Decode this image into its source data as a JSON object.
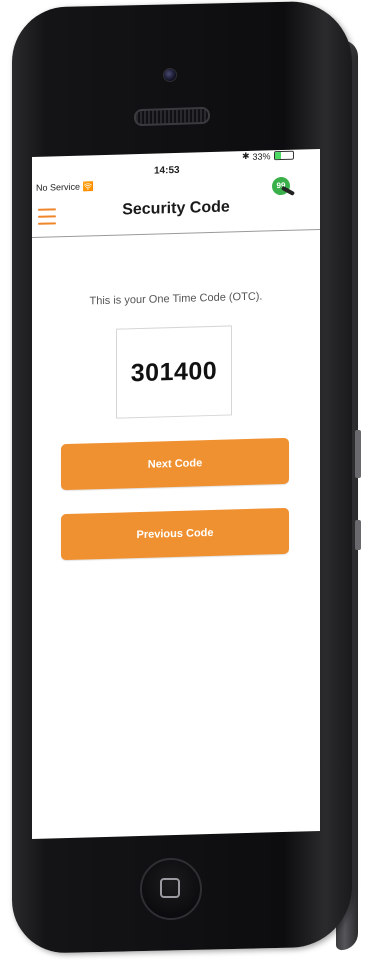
{
  "status_bar": {
    "carrier": "No Service",
    "time": "14:53",
    "battery_text": "33%",
    "battery_level": 0.33
  },
  "nav": {
    "title": "Security Code",
    "badge_count": "99"
  },
  "main": {
    "intro_text": "This is your One Time Code (OTC).",
    "code": "301400",
    "next_button_label": "Next Code",
    "previous_button_label": "Previous Code"
  },
  "colors": {
    "accent": "#f09131",
    "badge": "#3ab04a",
    "phone_body": "#141416"
  },
  "icons": {
    "menu": "hamburger-menu-icon",
    "badge": "key-badge-icon",
    "wifi": "wifi-icon",
    "bluetooth": "bluetooth-icon",
    "battery": "battery-icon",
    "home": "home-button-icon"
  }
}
